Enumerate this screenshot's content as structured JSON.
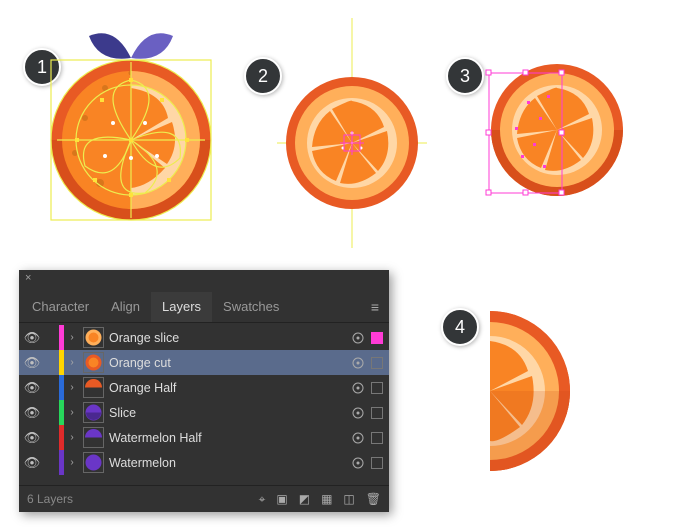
{
  "badges": {
    "b1": "1",
    "b2": "2",
    "b3": "3",
    "b4": "4"
  },
  "panel": {
    "close": "×",
    "tabs": {
      "character": "Character",
      "align": "Align",
      "layers": "Layers",
      "swatches": "Swatches"
    },
    "menu_icon": "≡",
    "layers": [
      {
        "name": "Orange slice",
        "color": "#ff3bd6",
        "selected": false,
        "selbox_fill": "#ff3bd6"
      },
      {
        "name": "Orange cut",
        "color": "#ffd400",
        "selected": true,
        "selbox_fill": ""
      },
      {
        "name": "Orange Half",
        "color": "#2a6bd9",
        "selected": false,
        "selbox_fill": ""
      },
      {
        "name": "Slice",
        "color": "#27d65b",
        "selected": false,
        "selbox_fill": ""
      },
      {
        "name": "Watermelon Half",
        "color": "#e02b2b",
        "selected": false,
        "selbox_fill": ""
      },
      {
        "name": "Watermelon",
        "color": "#6a36c7",
        "selected": false,
        "selbox_fill": ""
      }
    ],
    "footer": "6 Layers"
  },
  "colors": {
    "orange_dark": "#e85a24",
    "orange": "#f98424",
    "orange_light": "#ffaf5a",
    "cream": "#ffd7a6",
    "leaf1": "#3c3a8c",
    "leaf2": "#6a60c2",
    "guide": "#eded4f",
    "sel": "#ff3bd6",
    "anchor": "#ffe23a"
  }
}
